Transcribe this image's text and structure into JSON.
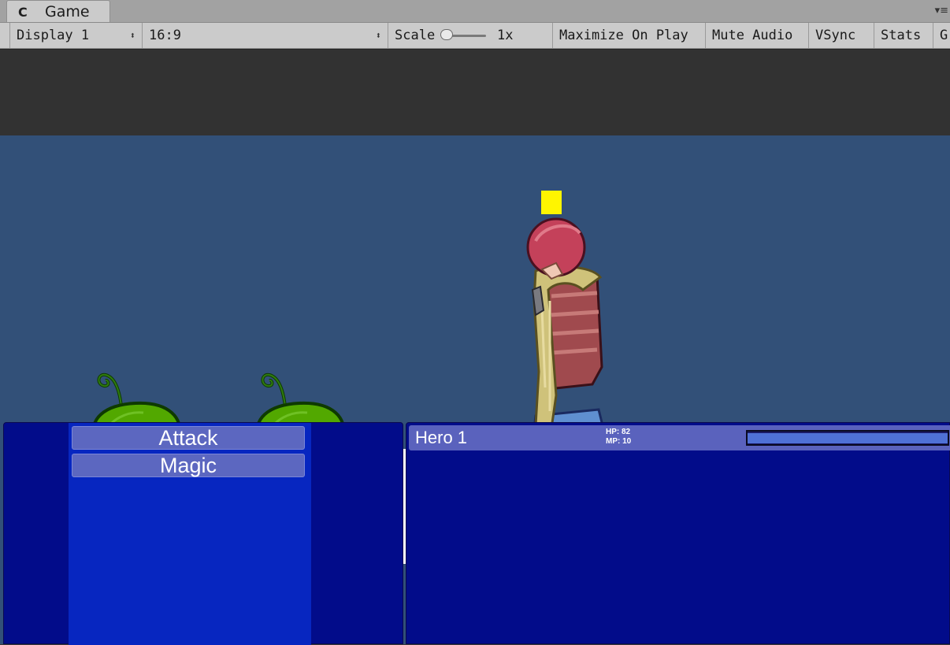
{
  "editor": {
    "tab_icon": "unity-icon",
    "tab_title": "Game",
    "tab_menu": "▾≡",
    "toolbar": {
      "display": "Display 1",
      "aspect": "16:9",
      "scale_label": "Scale",
      "scale_value": "1x",
      "maximize": "Maximize On Play",
      "mute": "Mute Audio",
      "vsync": "VSync",
      "stats": "Stats",
      "gizmos": "G"
    }
  },
  "game": {
    "colors": {
      "sky": "#325078",
      "floor": "#ffffff",
      "selector": "#fff500",
      "slime": "#52a800"
    },
    "enemies": [
      {
        "icon": "green-slime"
      },
      {
        "icon": "green-slime"
      }
    ],
    "commands": [
      {
        "label": "Attack"
      },
      {
        "label": "Magic"
      }
    ],
    "hero": {
      "name": "Hero 1",
      "hp": "HP: 82",
      "mp": "MP: 10",
      "atb_fraction": 1.0
    }
  }
}
